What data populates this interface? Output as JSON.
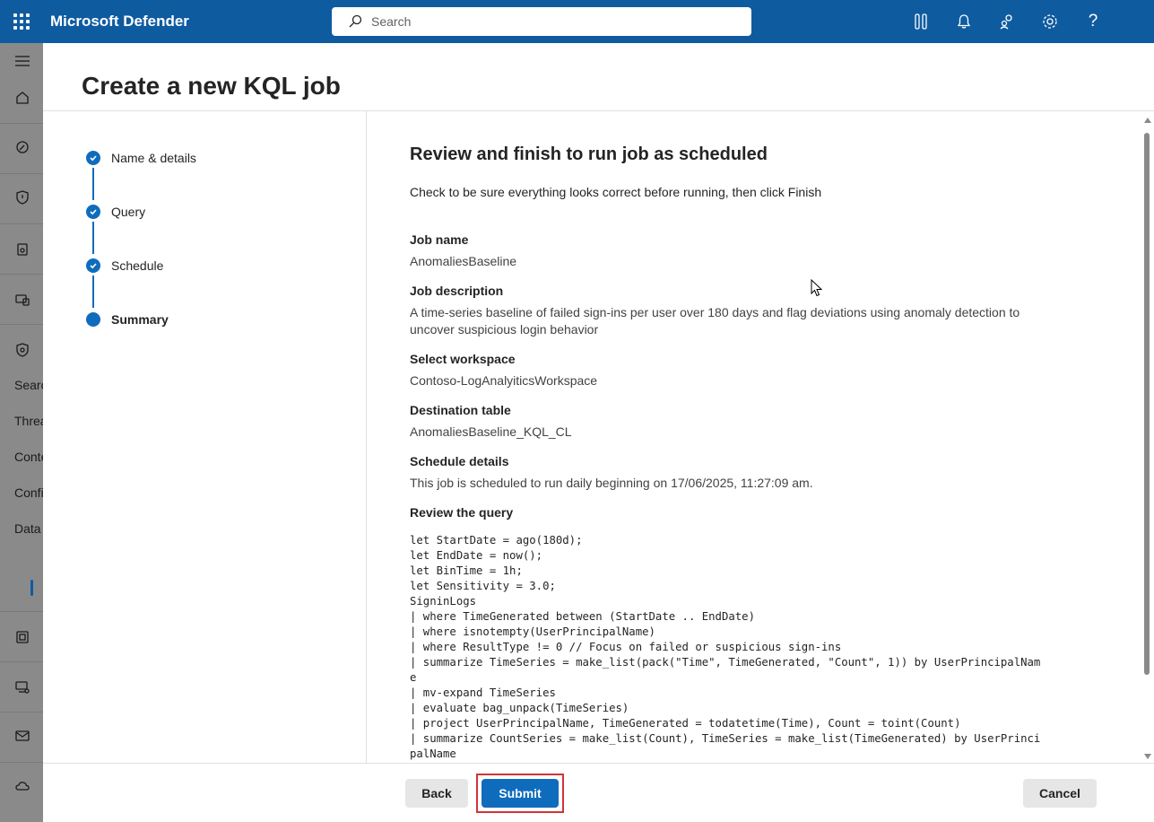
{
  "app": {
    "title": "Microsoft Defender"
  },
  "search": {
    "placeholder": "Search"
  },
  "leftnav": {
    "labels": [
      "Searc",
      "Threa",
      "Conte",
      "Confi",
      "Data"
    ]
  },
  "page": {
    "title": "Create a new KQL job"
  },
  "steps": [
    {
      "label": "Name & details",
      "state": "completed"
    },
    {
      "label": "Query",
      "state": "completed"
    },
    {
      "label": "Schedule",
      "state": "completed"
    },
    {
      "label": "Summary",
      "state": "current"
    }
  ],
  "review": {
    "title": "Review and finish to run job as scheduled",
    "subtitle": "Check to be sure everything looks correct before running, then click Finish",
    "job_name_label": "Job name",
    "job_name": "AnomaliesBaseline",
    "job_description_label": "Job description",
    "job_description": "A time-series baseline of failed sign-ins per user over 180 days and flag deviations using anomaly detection to uncover suspicious login behavior",
    "workspace_label": "Select workspace",
    "workspace": "Contoso-LogAnalyiticsWorkspace",
    "destination_label": "Destination table",
    "destination": "AnomaliesBaseline_KQL_CL",
    "schedule_label": "Schedule details",
    "schedule": "This job is scheduled to run daily beginning on 17/06/2025, 11:27:09 am.",
    "query_label": "Review the query",
    "query": "let StartDate = ago(180d);\nlet EndDate = now();\nlet BinTime = 1h;\nlet Sensitivity = 3.0;\nSigninLogs\n| where TimeGenerated between (StartDate .. EndDate)\n| where isnotempty(UserPrincipalName)\n| where ResultType != 0 // Focus on failed or suspicious sign-ins\n| summarize TimeSeries = make_list(pack(\"Time\", TimeGenerated, \"Count\", 1)) by UserPrincipalNam\ne\n| mv-expand TimeSeries\n| evaluate bag_unpack(TimeSeries)\n| project UserPrincipalName, TimeGenerated = todatetime(Time), Count = toint(Count)\n| summarize CountSeries = make_list(Count), TimeSeries = make_list(TimeGenerated) by UserPrinci\npalName"
  },
  "footer": {
    "back_label": "Back",
    "submit_label": "Submit",
    "cancel_label": "Cancel"
  },
  "colors": {
    "topbar": "#0f5ba0",
    "accent": "#0f6cbd",
    "highlight": "#d13438"
  }
}
